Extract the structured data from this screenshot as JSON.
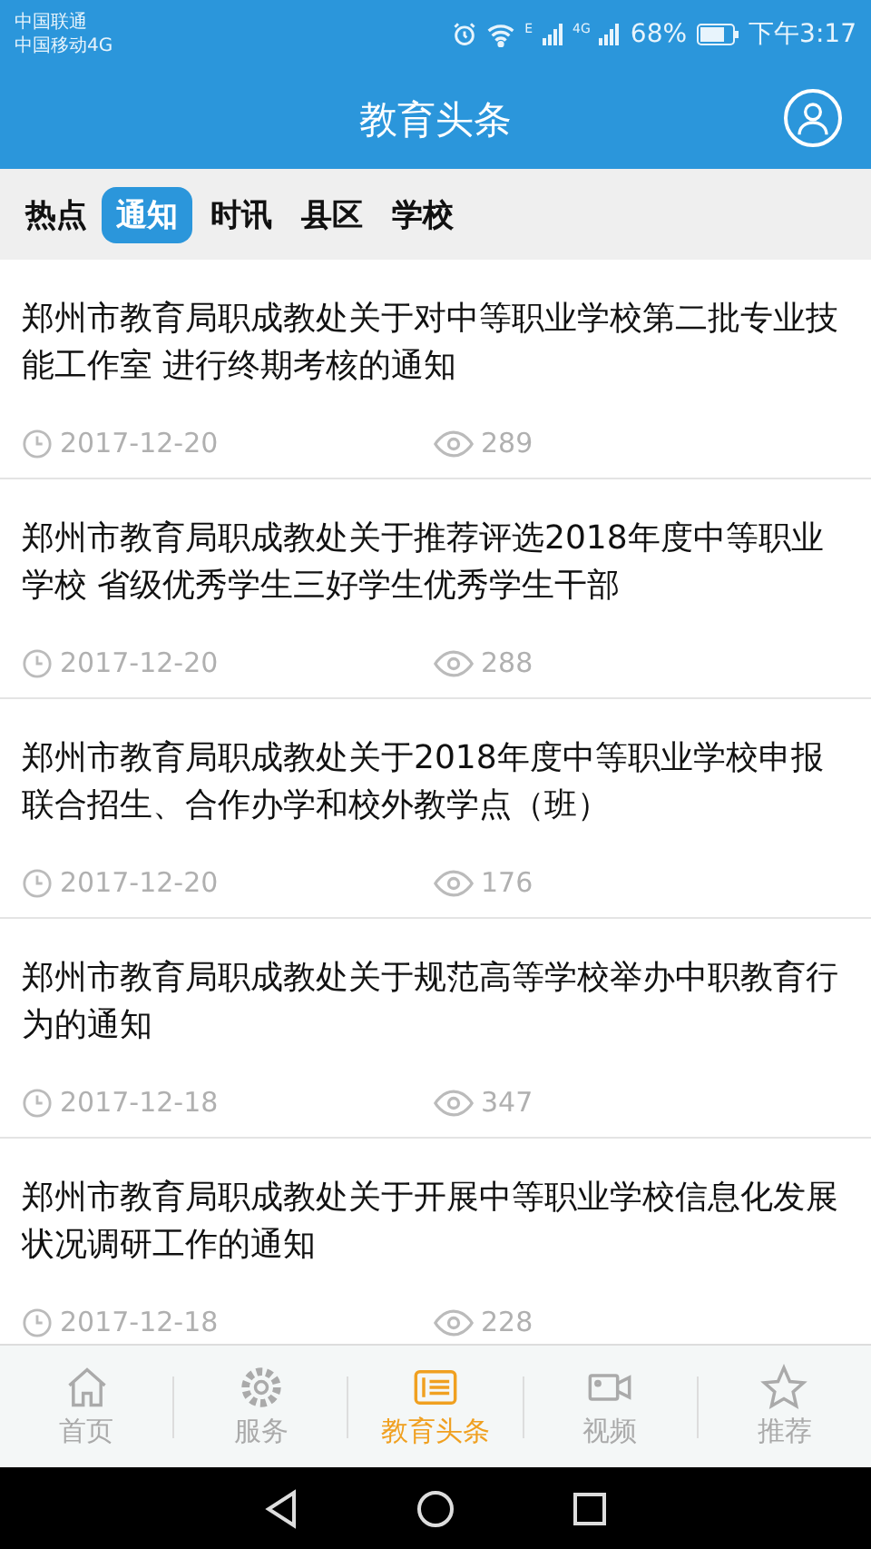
{
  "status_bar": {
    "carrier_1": "中国联通",
    "carrier_2": "中国移动4G",
    "network_1": "E",
    "network_2": "4G",
    "battery": "68%",
    "time": "下午3:17"
  },
  "header": {
    "title": "教育头条"
  },
  "tabs": [
    {
      "label": "热点",
      "selected": false
    },
    {
      "label": "通知",
      "selected": true
    },
    {
      "label": "时讯",
      "selected": false
    },
    {
      "label": "县区",
      "selected": false
    },
    {
      "label": "学校",
      "selected": false
    }
  ],
  "articles": [
    {
      "title": "郑州市教育局职成教处关于对中等职业学校第二批专业技能工作室 进行终期考核的通知",
      "date": "2017-12-20",
      "views": "289"
    },
    {
      "title": "郑州市教育局职成教处关于推荐评选2018年度中等职业学校 省级优秀学生三好学生优秀学生干部",
      "date": "2017-12-20",
      "views": "288"
    },
    {
      "title": "郑州市教育局职成教处关于2018年度中等职业学校申报联合招生、合作办学和校外教学点（班）",
      "date": "2017-12-20",
      "views": "176"
    },
    {
      "title": "郑州市教育局职成教处关于规范高等学校举办中职教育行为的通知",
      "date": "2017-12-18",
      "views": "347"
    },
    {
      "title": "郑州市教育局职成教处关于开展中等职业学校信息化发展状况调研工作的通知",
      "date": "2017-12-18",
      "views": "228"
    }
  ],
  "bottom_nav": [
    {
      "kind": "home",
      "label": "首页",
      "selected": false
    },
    {
      "kind": "service",
      "label": "服务",
      "selected": false
    },
    {
      "kind": "news",
      "label": "教育头条",
      "selected": true
    },
    {
      "kind": "video",
      "label": "视频",
      "selected": false
    },
    {
      "kind": "star",
      "label": "推荐",
      "selected": false
    }
  ]
}
